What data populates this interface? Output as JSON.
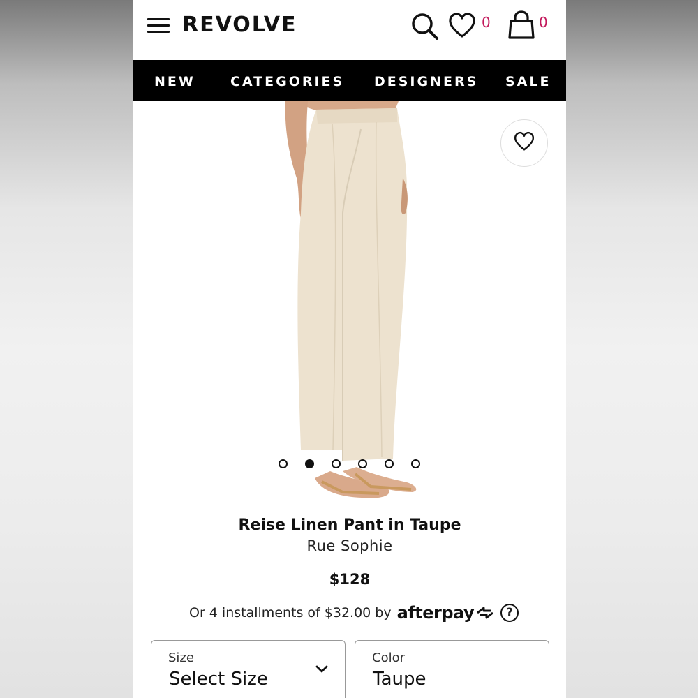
{
  "header": {
    "logo": "REVOLVE",
    "wishlist_count": "0",
    "cart_count": "0",
    "badge_color": "#c2185b"
  },
  "nav": {
    "items": [
      {
        "label": "NEW"
      },
      {
        "label": "CATEGORIES"
      },
      {
        "label": "DESIGNERS"
      },
      {
        "label": "SALE"
      }
    ]
  },
  "gallery": {
    "image": "product-photo",
    "slide_count": 6,
    "active_slide": 2
  },
  "product": {
    "title": "Reise Linen Pant in Taupe",
    "brand": "Rue Sophie",
    "price": "$128",
    "installments_text": "Or 4 installments of $32.00 by",
    "afterpay_logo": "afterpay",
    "help_glyph": "?"
  },
  "options": {
    "size": {
      "label": "Size",
      "value": "Select Size"
    },
    "color": {
      "label": "Color",
      "value": "Taupe"
    }
  }
}
